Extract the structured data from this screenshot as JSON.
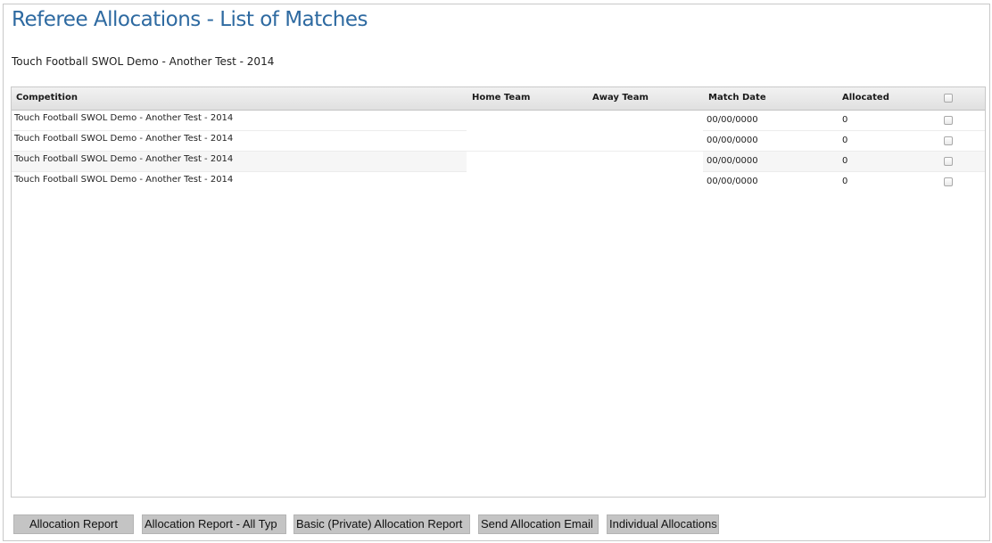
{
  "page": {
    "title": "Referee Allocations - List of Matches",
    "subtitle": "Touch Football SWOL Demo - Another Test - 2014"
  },
  "table": {
    "columns": {
      "competition": "Competition",
      "home_team": "Home Team",
      "away_team": "Away Team",
      "match_date": "Match Date",
      "allocated": "Allocated"
    },
    "rows": [
      {
        "competition": "Touch Football SWOL Demo - Another Test - 2014",
        "home_team": "",
        "away_team": "",
        "match_date": "00/00/0000",
        "allocated": "0",
        "checked": false
      },
      {
        "competition": "Touch Football SWOL Demo - Another Test - 2014",
        "home_team": "",
        "away_team": "",
        "match_date": "00/00/0000",
        "allocated": "0",
        "checked": false
      },
      {
        "competition": "Touch Football SWOL Demo - Another Test - 2014",
        "home_team": "",
        "away_team": "",
        "match_date": "00/00/0000",
        "allocated": "0",
        "checked": false
      },
      {
        "competition": "Touch Football SWOL Demo - Another Test - 2014",
        "home_team": "",
        "away_team": "",
        "match_date": "00/00/0000",
        "allocated": "0",
        "checked": false
      }
    ]
  },
  "buttons": {
    "allocation_report": "Allocation Report",
    "allocation_report_all": "Allocation Report - All Typ",
    "basic_private_report": "Basic (Private) Allocation Report",
    "send_email": "Send Allocation Email",
    "individual_allocations": "Individual Allocations"
  },
  "colors": {
    "title": "#2e6aa1",
    "button_bg": "#c4c4c4",
    "header_bg": "#e8e8e8"
  }
}
